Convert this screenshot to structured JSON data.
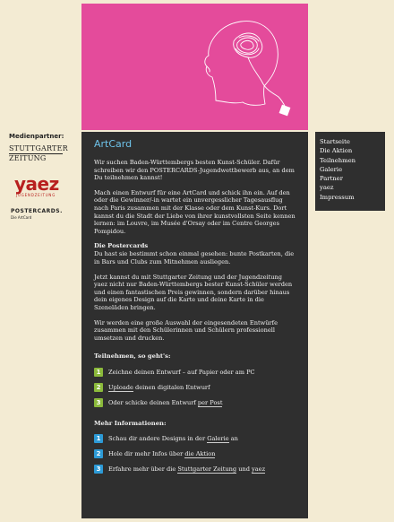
{
  "partners": {
    "title": "Medienpartner:",
    "stz": {
      "line1": "STUTTGARTER",
      "line2": "ZEITUNG"
    },
    "yaez": {
      "name": "yaez",
      "sub": "JUGENDZEITUNG"
    },
    "postercards": {
      "name": "POSTERCARDS.",
      "sub": "Die ArtCard"
    }
  },
  "nav": {
    "items": [
      "Startseite",
      "Die Aktion",
      "Teilnehmen",
      "Galerie",
      "Partner",
      "yaez",
      "Impressum"
    ]
  },
  "main": {
    "title": "ArtCard",
    "intro": "Wir suchen Baden-Württembergs besten Kunst-Schüler. Dafür schreiben wir den POSTERCARDS-Jugendwettbewerb aus, an dem Du teilnehmen kannst!",
    "p2": "Mach einen Entwurf für eine ArtCard und schick ihn ein. Auf den oder die Gewinner/-in wartet ein unvergesslicher Tagesausflug nach Paris zusammen mit der Klasse oder dem Kunst-Kurs. Dort kannst du die Stadt der Liebe von ihrer kunstvollsten Seite kennen lernen: im Louvre, im Musée d'Orsay oder im Centre Georges Pompidou.",
    "postercards_heading": "Die Postercards",
    "postercards_text": "Du hast sie bestimmt schon einmal gesehen: bunte Postkarten, die in Bars und Clubs zum Mitnehmen ausliegen.",
    "p4": "Jetzt kannst du mit Stuttgarter Zeitung und der Jugendzeitung yaez nicht nur Baden-Württembergs bester Kunst-Schüler werden und einen fantastischen Preis gewinnen, sondern darüber hinaus dein eigenes Design auf die Karte und deine Karte in die Szeneläden bringen.",
    "p5": "Wir werden eine große Auswahl der eingesendeten Entwürfe zusammen mit den Schülerinnen und Schülern professionell umsetzen und drucken.",
    "teilnehmen_heading": "Teilnehmen, so geht's:",
    "steps": [
      {
        "num": "1",
        "before": "Zeichne deinen Entwurf – auf Papier oder am PC",
        "link": "",
        "after": ""
      },
      {
        "num": "2",
        "before": "",
        "link": "Uploade",
        "after": " deinen digitalen Entwurf"
      },
      {
        "num": "3",
        "before": "Oder schicke deinen Entwurf ",
        "link": "per Post",
        "after": ""
      }
    ],
    "info_heading": "Mehr Informationen:",
    "info": [
      {
        "num": "1",
        "before": "Schau dir andere Designs in der ",
        "link": "Galerie",
        "after": " an",
        "link2": "",
        "after2": ""
      },
      {
        "num": "2",
        "before": "Hole dir mehr Infos über ",
        "link": "die Aktion",
        "after": "",
        "link2": "",
        "after2": ""
      },
      {
        "num": "3",
        "before": "Erfahre mehr über die ",
        "link": "Stuttgarter Zeitung",
        "after": " und ",
        "link2": "yaez",
        "after2": ""
      }
    ]
  },
  "colors": {
    "pink": "#e44b9b",
    "panel": "#2f2f2f",
    "title_blue": "#6ec3ea",
    "green": "#8bb93b",
    "blue": "#2d9ad6"
  }
}
